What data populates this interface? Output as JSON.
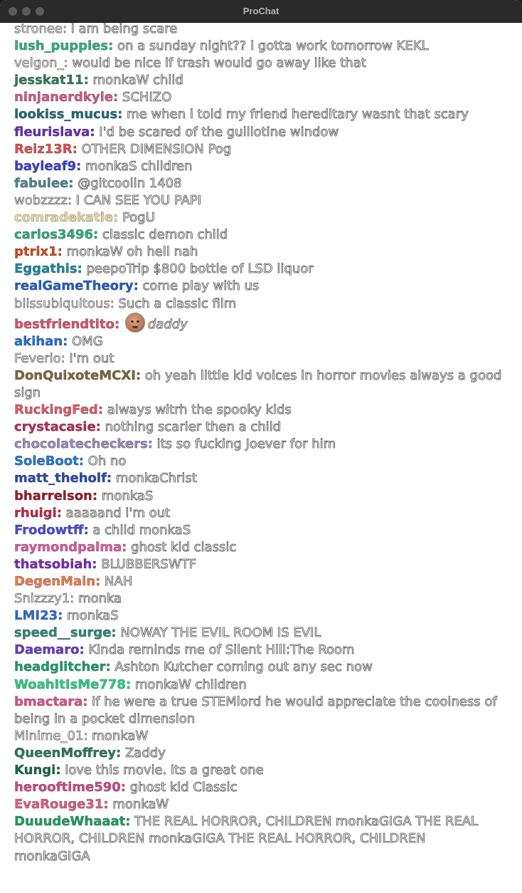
{
  "window": {
    "title": "ProChat"
  },
  "messages": [
    {
      "user": "stronee:",
      "color": "#ffffff",
      "text": "i am being scare"
    },
    {
      "user": "lush_puppies:",
      "color": "#2fb37e",
      "text": "on a sunday night?? i gotta work tomorrow KEKL"
    },
    {
      "user": "velgon_:",
      "color": "#ffffff",
      "text": "would be nice if trash would go away like that"
    },
    {
      "user": "jesskat11:",
      "color": "#2e7d57",
      "text": "monkaW child"
    },
    {
      "user": "ninjanerdkyle:",
      "color": "#d15b86",
      "text": "SCHIZO"
    },
    {
      "user": "lookiss_mucus:",
      "color": "#1f6b7a",
      "text": "me when i told my friend hereditary wasnt that scary"
    },
    {
      "user": "fleurislava:",
      "color": "#6a2bb8",
      "text": "I'd be scared of the guillotine window"
    },
    {
      "user": "Reiz13R:",
      "color": "#e05050",
      "text": "OTHER DIMENSION Pog"
    },
    {
      "user": "bayleaf9:",
      "color": "#3a3fd0",
      "text": "monkaS children"
    },
    {
      "user": "fabulee:",
      "color": "#4a8a8a",
      "text": "@gitcoolin 1408"
    },
    {
      "user": "wobzzzz:",
      "color": "#ffffff",
      "text": "I CAN SEE YOU PAPI"
    },
    {
      "user": "comradekatie:",
      "color": "#e6dca0",
      "text": "PogU"
    },
    {
      "user": "carlos3496:",
      "color": "#2ab07a",
      "text": "classic demon child"
    },
    {
      "user": "ptrix1:",
      "color": "#d04a1a",
      "text": "monkaW oh hell nah"
    },
    {
      "user": "Eggathis:",
      "color": "#1a8a9a",
      "text": "peepoTrip $800 bottle of LSD liquor"
    },
    {
      "user": "realGameTheory:",
      "color": "#1f5fd0",
      "text": "come play with us"
    },
    {
      "user": "blissubiquitous:",
      "color": "#ffffff",
      "text": "Such a classic film"
    },
    {
      "user": "bestfriendtito:",
      "color": "#e0506a",
      "text": "daddy",
      "emote": true
    },
    {
      "user": "akihan:",
      "color": "#1f6fd8",
      "text": "OMG"
    },
    {
      "user": "Feverio:",
      "color": "#ffffff",
      "text": "I'm out"
    },
    {
      "user": "DonQuixoteMCXI:",
      "color": "#7a6a3a",
      "text": "oh yeah little kid voices in horror movies always a good sign"
    },
    {
      "user": "RuckingFed:",
      "color": "#e05a6a",
      "text": "always witrh the spooky kids"
    },
    {
      "user": "crystacasie:",
      "color": "#c0285a",
      "text": "nothing scarier then a child"
    },
    {
      "user": "chocolatecheckers:",
      "color": "#9a8ac0",
      "text": "its so fucking Joever for him"
    },
    {
      "user": "SoleBoot:",
      "color": "#1f7ad8",
      "text": "Oh no"
    },
    {
      "user": "matt_theholf:",
      "color": "#2a4ab0",
      "text": "monkaChrist"
    },
    {
      "user": "bharrelson:",
      "color": "#a01a2a",
      "text": "monkaS"
    },
    {
      "user": "rhuigi:",
      "color": "#c0284a",
      "text": "aaaaand i'm out"
    },
    {
      "user": "Frodowtff:",
      "color": "#4a4ae0",
      "text": "a child monkaS"
    },
    {
      "user": "raymondpalma:",
      "color": "#e05aa0",
      "text": "ghost kid classic"
    },
    {
      "user": "thatsobiah:",
      "color": "#7a2ab8",
      "text": "BLUBBERSWTF"
    },
    {
      "user": "DegenMain:",
      "color": "#f07a4a",
      "text": "NAH"
    },
    {
      "user": "Snizzzy1:",
      "color": "#ffffff",
      "text": "monka"
    },
    {
      "user": "LMI23:",
      "color": "#2a6ad8",
      "text": "monkaS"
    },
    {
      "user": "speed__surge:",
      "color": "#2a8a7a",
      "text": "NOWAY THE EVIL ROOM IS EVIL"
    },
    {
      "user": "Daemaro:",
      "color": "#6a3ad0",
      "text": "Kinda reminds me of Silent Hill:The Room"
    },
    {
      "user": "headglitcher:",
      "color": "#1aa070",
      "text": "Ashton Kutcher coming out any sec now"
    },
    {
      "user": "WoahItIsMe778:",
      "color": "#2ad080",
      "text": "monkaW children"
    },
    {
      "user": "bmactara:",
      "color": "#e0508a",
      "text": "if he were a true STEMlord he would appreciate the coolness of being in a pocket dimension"
    },
    {
      "user": "Minime_01:",
      "color": "#ffffff",
      "text": "monkaW"
    },
    {
      "user": "QueenMoffrey:",
      "color": "#2a7a5a",
      "text": "Zaddy"
    },
    {
      "user": "Kungi:",
      "color": "#1a6a4a",
      "text": "love this movie. its a great one"
    },
    {
      "user": "herooftime590:",
      "color": "#d04a8a",
      "text": "ghost kid Classic"
    },
    {
      "user": "EvaRouge31:",
      "color": "#e05a8a",
      "text": "monkaW"
    },
    {
      "user": "DuuudeWhaaat:",
      "color": "#1aa060",
      "text": "THE REAL HORROR, CHILDREN monkaGIGA THE REAL HORROR, CHILDREN monkaGIGA THE REAL HORROR, CHILDREN monkaGIGA"
    }
  ]
}
